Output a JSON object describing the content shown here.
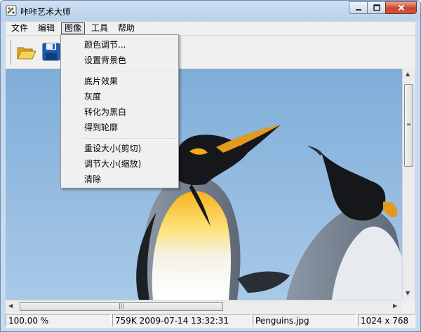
{
  "window": {
    "title": "咔咔艺术大师",
    "controls": {
      "minimize_icon": "minimize-icon",
      "maximize_icon": "maximize-icon",
      "close_icon": "close-icon"
    }
  },
  "menubar": {
    "items": [
      {
        "label": "文件"
      },
      {
        "label": "编辑"
      },
      {
        "label": "图像",
        "active": true
      },
      {
        "label": "工具"
      },
      {
        "label": "帮助"
      }
    ]
  },
  "toolbar": {
    "buttons": [
      {
        "icon": "folder-open-icon"
      },
      {
        "icon": "save-disk-icon"
      }
    ]
  },
  "image_menu": {
    "groups": [
      [
        "颜色调节...",
        "设置背景色"
      ],
      [
        "底片效果",
        "灰度",
        "转化为黑白",
        "得到轮廓"
      ],
      [
        "重设大小(剪切)",
        "调节大小(缩放)",
        "清除"
      ]
    ]
  },
  "statusbar": {
    "zoom": "100.00 %",
    "file_info": "759K 2009-07-14 13:32:31",
    "file_name": "Penguins.jpg",
    "dimensions": "1024 x 768"
  },
  "colors": {
    "title_bar": "#c7daf0",
    "menu_bg": "#f0f0f0",
    "sky": "#8fb6dd",
    "close_button": "#c7452c"
  }
}
